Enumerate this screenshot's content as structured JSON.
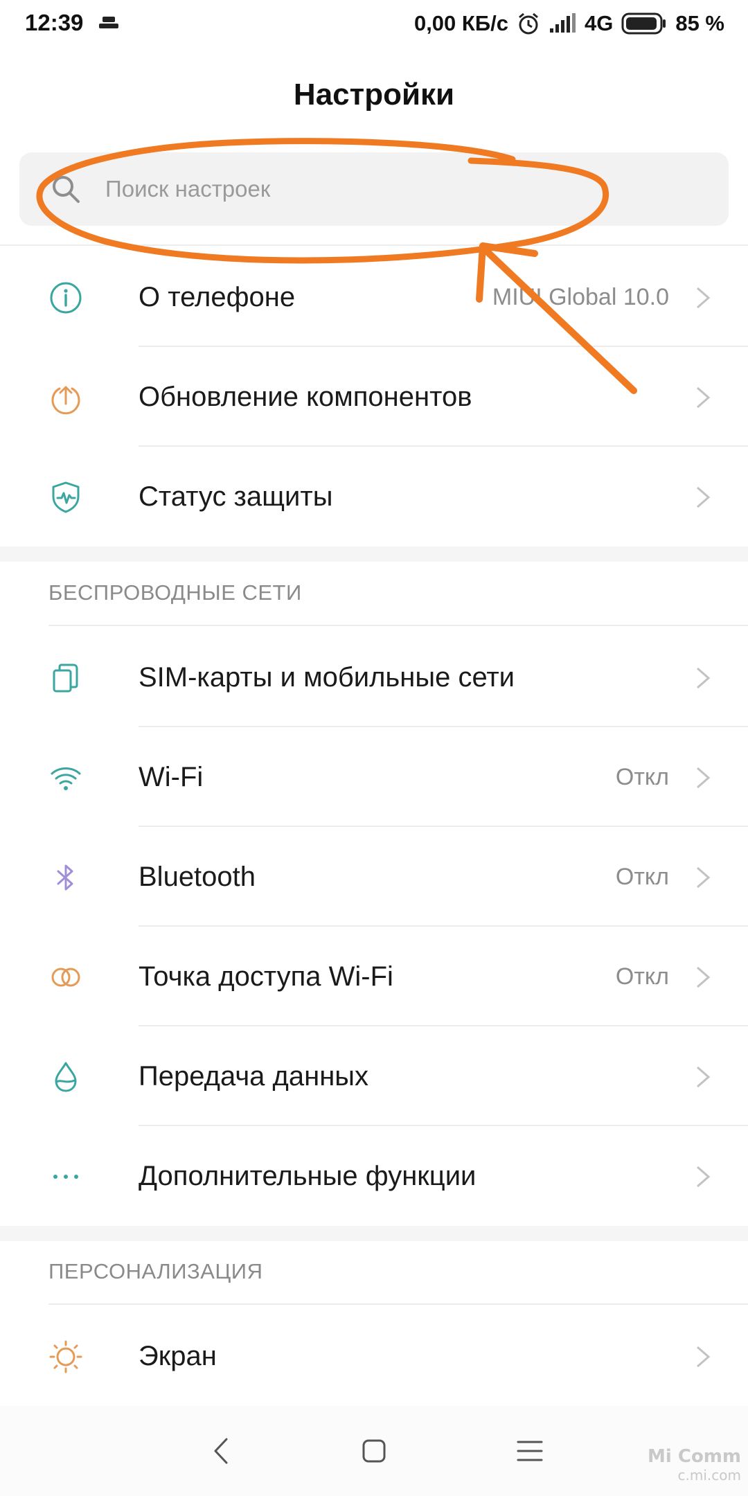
{
  "status_bar": {
    "time": "12:39",
    "network_speed": "0,00 КБ/с",
    "network_type": "4G",
    "battery": "85 %"
  },
  "header": {
    "title": "Настройки"
  },
  "search": {
    "placeholder": "Поиск настроек"
  },
  "top_group": [
    {
      "icon": "info-icon",
      "label": "О телефоне",
      "value": "MIUI Global 10.0"
    },
    {
      "icon": "update-icon",
      "label": "Обновление компонентов",
      "value": ""
    },
    {
      "icon": "shield-icon",
      "label": "Статус защиты",
      "value": ""
    }
  ],
  "wireless": {
    "header": "БЕСПРОВОДНЫЕ СЕТИ",
    "items": [
      {
        "icon": "sim-card-icon",
        "label": "SIM-карты и мобильные сети",
        "value": ""
      },
      {
        "icon": "wifi-icon",
        "label": "Wi-Fi",
        "value": "Откл"
      },
      {
        "icon": "bluetooth-icon",
        "label": "Bluetooth",
        "value": "Откл"
      },
      {
        "icon": "hotspot-icon",
        "label": "Точка доступа Wi-Fi",
        "value": "Откл"
      },
      {
        "icon": "data-drop-icon",
        "label": "Передача данных",
        "value": ""
      },
      {
        "icon": "more-dots-icon",
        "label": "Дополнительные функции",
        "value": ""
      }
    ]
  },
  "personalization": {
    "header": "ПЕРСОНАЛИЗАЦИЯ",
    "items": [
      {
        "icon": "sun-icon",
        "label": "Экран",
        "value": ""
      }
    ]
  },
  "watermark": {
    "line1": "Mi Comm",
    "line2": "c.mi.com"
  },
  "colors": {
    "teal": "#3aa6a0",
    "orange_icon": "#e59a55",
    "purple": "#a08fd8",
    "annotation_orange": "#f07a21"
  }
}
